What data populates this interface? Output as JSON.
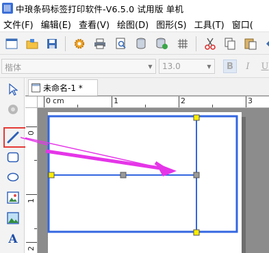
{
  "window": {
    "title": "中琅条码标签打印软件-V6.5.0 试用版 单机",
    "app_icon": "barcode-app-icon"
  },
  "menu": {
    "items": [
      {
        "label": "文件(F)"
      },
      {
        "label": "编辑(E)"
      },
      {
        "label": "查看(V)"
      },
      {
        "label": "绘图(D)"
      },
      {
        "label": "图形(S)"
      },
      {
        "label": "工具(T)"
      },
      {
        "label": "窗口("
      }
    ]
  },
  "toolbar": {
    "buttons": [
      "new-icon",
      "open-folder-icon",
      "save-icon",
      "settings-gear-icon",
      "print-icon",
      "print-preview-icon",
      "database-icon",
      "database-setting-icon",
      "grid-icon",
      "cut-icon",
      "copy-icon",
      "paste-icon"
    ]
  },
  "format_toolbar": {
    "font_value": "楷体",
    "size_value": "13.0",
    "bold_label": "B",
    "italic_label": "I",
    "underline_label": "U"
  },
  "left_tools": {
    "tools": [
      "select-pointer-icon",
      "pan-hand-icon",
      "line-tool-icon",
      "rounded-rect-tool-icon",
      "ellipse-tool-icon",
      "image-tool-icon",
      "picture-tool-icon",
      "text-tool-icon"
    ],
    "highlighted_tool": "line-tool-icon"
  },
  "document": {
    "tab_label": "未命名-1 *",
    "ruler_unit": "cm",
    "ruler_top_numbers": [
      "0",
      "1",
      "2",
      "3"
    ],
    "ruler_left_numbers": [
      "0",
      "1",
      "2"
    ]
  },
  "colors": {
    "shape_stroke": "#3366e0",
    "handle_fill": "#ffee00",
    "handle_mid_fill": "#9a9a9a",
    "annotation_arrow": "#e535e8",
    "highlight_box": "#e53935",
    "canvas_bg": "#8c8c8c"
  }
}
